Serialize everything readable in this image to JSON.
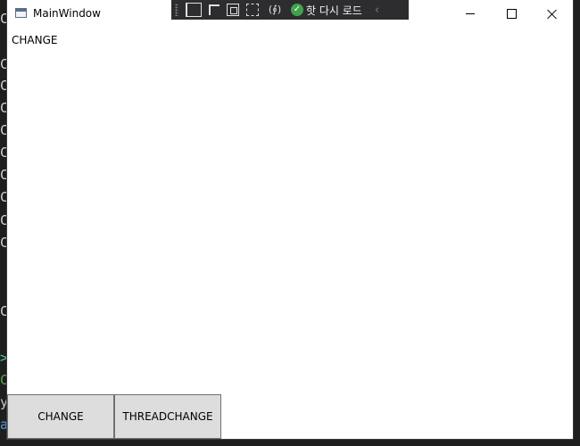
{
  "window": {
    "title": "MainWindow"
  },
  "debug_toolbar": {
    "icons": [
      "visual-tree-icon",
      "select-element-icon",
      "display-layout-adorners-icon",
      "track-focus-icon",
      "binding-failures-icon",
      "hot-reload-ok-icon",
      "collapse-chevron-icon"
    ],
    "hot_reload_label": "핫 다시 로드",
    "binding_glyph": "(∮)",
    "check_glyph": "✓",
    "chevron_glyph": "‹"
  },
  "content": {
    "text_label": "CHANGE",
    "change_button": "CHANGE",
    "threadchange_button": "THREADCHANGE"
  },
  "backdrop": {
    "code_fragments": [
      "C",
      "C",
      "C",
      "C",
      "C",
      "C",
      "C",
      "C",
      "C",
      "C",
      "C",
      "C",
      ">",
      "C",
      "y",
      "a"
    ]
  },
  "colors": {
    "button_face": "#dddddd",
    "button_border": "#707070",
    "toolbar_bg": "#2d2d30",
    "hot_reload_ok": "#3fa34d"
  }
}
